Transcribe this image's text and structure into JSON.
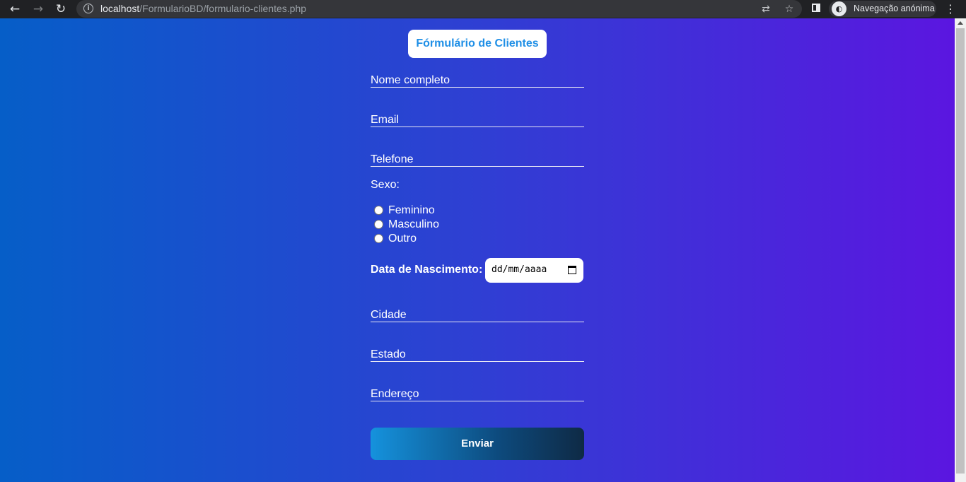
{
  "browser": {
    "url_host": "localhost",
    "url_path": "/FormularioBD/formulario-clientes.php",
    "profile_label": "Navegação anónima",
    "icons": [
      "back-icon",
      "forward-icon",
      "reload-icon",
      "info-icon",
      "translate-icon",
      "star-icon",
      "side-panel-icon",
      "incognito-icon",
      "menu-icon"
    ]
  },
  "form": {
    "title": "Fórmulário de Clientes",
    "fields": {
      "nome": "Nome completo",
      "email": "Email",
      "telefone": "Telefone",
      "cidade": "Cidade",
      "estado": "Estado",
      "endereco": "Endereço"
    },
    "sexo": {
      "label": "Sexo:",
      "options": [
        "Feminino",
        "Masculino",
        "Outro"
      ]
    },
    "nascimento": {
      "label": "Data de Nascimento:",
      "placeholder": "dd/mm/aaaa"
    },
    "submit_label": "Enviar"
  },
  "colors": {
    "gradient_start": "#065ec8",
    "gradient_end": "#5b16e0",
    "title_text": "#1f8fe6",
    "button_start": "#1592dd",
    "button_end": "#0e2a45"
  }
}
